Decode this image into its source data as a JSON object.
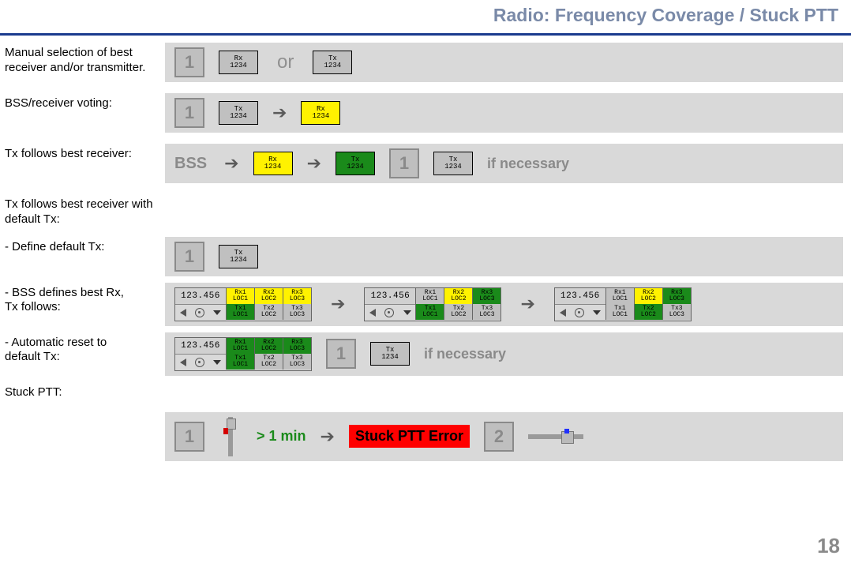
{
  "title": "Radio: Frequency Coverage / Stuck PTT",
  "page_number": "18",
  "labels": {
    "manual": "Manual selection of best receiver and/or transmitter.",
    "bss_voting": "BSS/receiver voting:",
    "tx_follows": "Tx follows best receiver:",
    "tx_follows_def": "Tx follows best receiver with default Tx:",
    "define_def": "- Define default Tx:",
    "bss_defines": "- BSS defines best Rx,\n  Tx follows:",
    "auto_reset": "- Automatic reset to\n   default Tx:",
    "stuck_ptt": "Stuck PTT:"
  },
  "step": {
    "one": "1",
    "two": "2"
  },
  "text": {
    "or": "or",
    "bss": "BSS",
    "arrow": "➔",
    "if_necessary": "if necessary",
    "gt1min": "> 1 min",
    "stuck_err": "Stuck PTT Error"
  },
  "btn": {
    "rx1234_a": "Rx",
    "rx1234_b": "1234",
    "tx1234_a": "Tx",
    "tx1234_b": "1234"
  },
  "panel": {
    "freq": "123.456",
    "rx1a": "Rx1",
    "rx1b": "LOC1",
    "rx2a": "Rx2",
    "rx2b": "LOC2",
    "rx3a": "Rx3",
    "rx3b": "LOC3",
    "tx1a": "Tx1",
    "tx1b": "LOC1",
    "tx2a": "Tx2",
    "tx2b": "LOC2",
    "tx3a": "Tx3",
    "tx3b": "LOC3"
  }
}
